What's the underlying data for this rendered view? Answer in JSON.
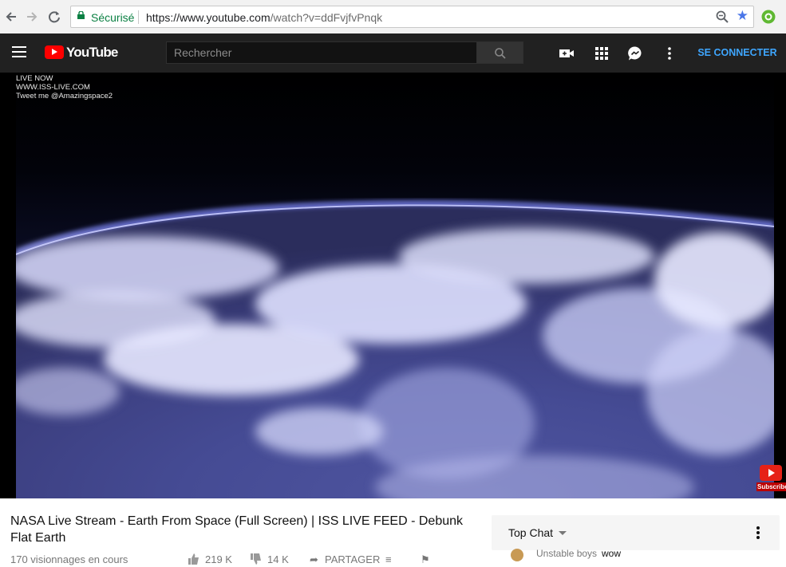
{
  "browser": {
    "secure_label": "Sécurisé",
    "url_host": "https://www.youtube.com",
    "url_path": "/watch?v=ddFvjfvPnqk"
  },
  "masthead": {
    "logo_text": "YouTube",
    "search_placeholder": "Rechercher",
    "signin_label": "SE CONNECTER",
    "icons": [
      "menu-icon",
      "upload-video-icon",
      "apps-grid-icon",
      "messages-icon",
      "more-vert-icon",
      "search-icon"
    ]
  },
  "player": {
    "overlay_lines": [
      "LIVE NOW",
      "WWW.ISS-LIVE.COM",
      "Tweet me @Amazingspace2"
    ],
    "subscribe_label": "Subscribe"
  },
  "video": {
    "title": "NASA Live Stream - Earth From Space (Full Screen) | ISS LIVE FEED - Debunk Flat Earth",
    "viewers": "170 visionnages en cours",
    "likes": "219 K",
    "dislikes": "14 K",
    "share_label": "PARTAGER"
  },
  "chat": {
    "title": "Top Chat",
    "messages": [
      {
        "author": "Unstable boys",
        "text": "wow"
      }
    ]
  },
  "colors": {
    "youtube_red": "#ff0000",
    "masthead_bg": "#212121",
    "signin_blue": "#3ea6ff",
    "secure_green": "#0b8043"
  }
}
